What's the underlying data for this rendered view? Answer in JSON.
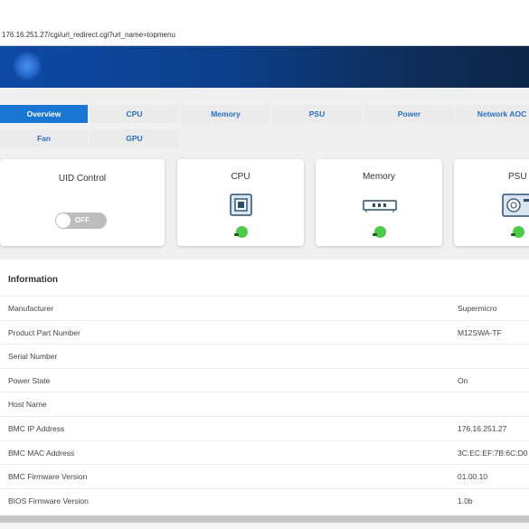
{
  "browser": {
    "url": "176.16.251.27/cgi/url_redirect.cgi?url_name=topmenu"
  },
  "tabs_row1": [
    "Overview",
    "CPU",
    "Memory",
    "PSU",
    "Power",
    "Network AOC"
  ],
  "tabs_row2": [
    "Fan",
    "GPU"
  ],
  "active_tab": "Overview",
  "cards": {
    "uid": {
      "title": "UID Control",
      "toggle_label": "OFF"
    },
    "cpu": {
      "title": "CPU",
      "icon": "cpu-chip-icon",
      "status": "ok"
    },
    "memory": {
      "title": "Memory",
      "icon": "memory-module-icon",
      "status": "ok"
    },
    "psu": {
      "title": "PSU",
      "icon": "power-supply-icon",
      "status": "ok"
    }
  },
  "information": {
    "title": "Information",
    "rows": [
      {
        "key": "Manufacturer",
        "value": "Supermicro"
      },
      {
        "key": "Product Part Number",
        "value": "M12SWA-TF"
      },
      {
        "key": "Serial Number",
        "value": ""
      },
      {
        "key": "Power State",
        "value": "On"
      },
      {
        "key": "Host Name",
        "value": ""
      },
      {
        "key": "BMC IP Address",
        "value": "176.16.251.27"
      },
      {
        "key": "BMC MAC Address",
        "value": "3C:EC:EF:7B:6C:D0"
      },
      {
        "key": "BMC Firmware Version",
        "value": "01.00.10"
      },
      {
        "key": "BIOS Firmware Version",
        "value": "1.0b"
      }
    ]
  },
  "colors": {
    "accent": "#1976d2",
    "status_ok": "#4fc94a",
    "banner": "#0c3f88"
  }
}
